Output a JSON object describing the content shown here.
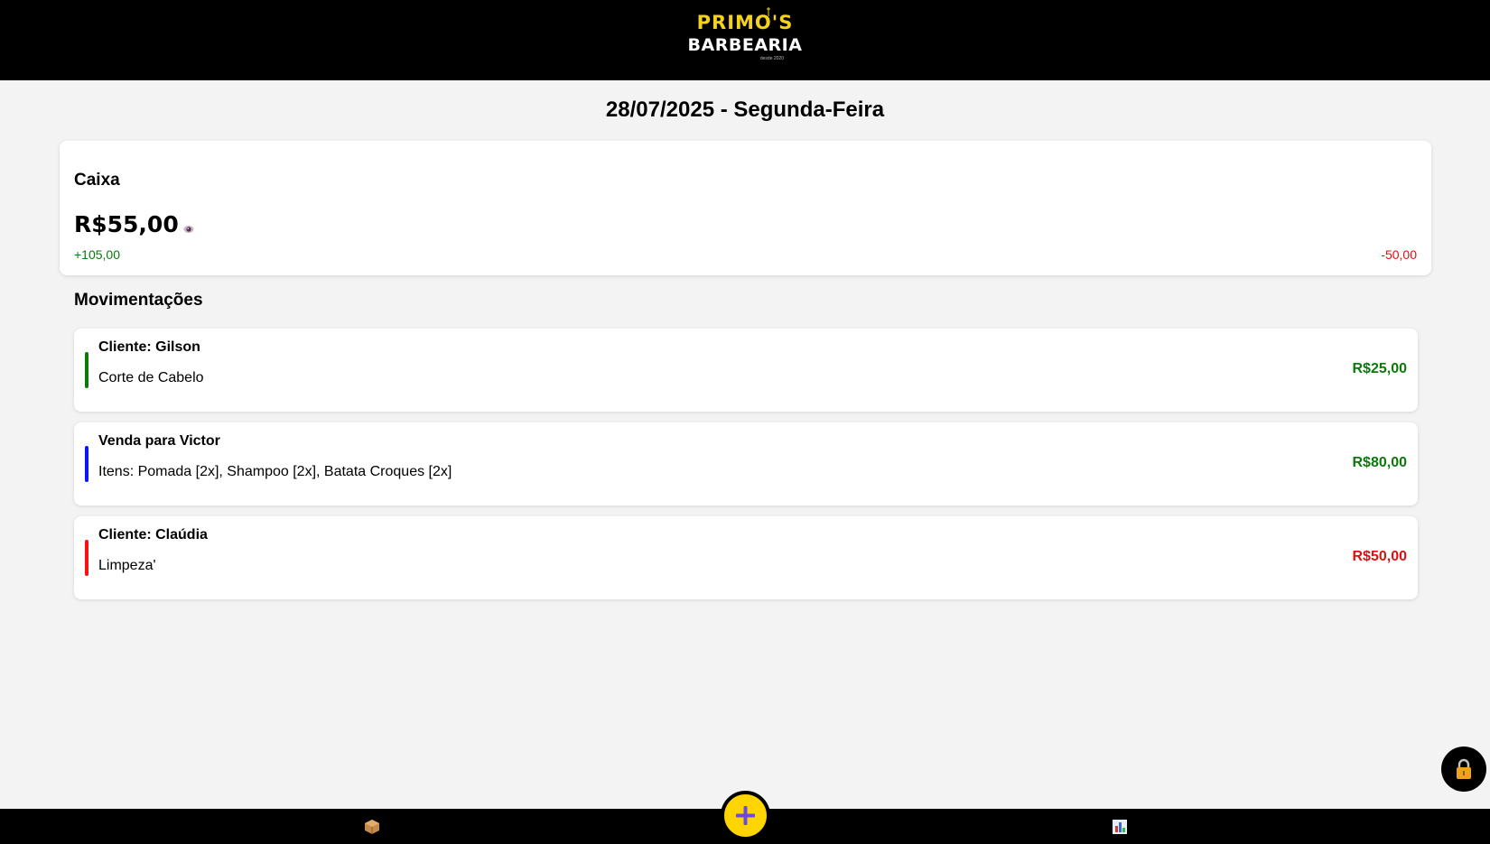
{
  "header": {
    "logo_line1": "PRIMO'S",
    "logo_line2": "BARBEARIA",
    "logo_tagline": "desde 2020"
  },
  "date_title": "28/07/2025 - Segunda-Feira",
  "cash": {
    "label": "Caixa",
    "balance": "R$55,00",
    "incoming": "+105,00",
    "outgoing": "-50,00"
  },
  "movements": {
    "title": "Movimentações",
    "items": [
      {
        "title": "Cliente: Gilson",
        "description": "Corte de Cabelo",
        "amount": "R$25,00",
        "bar_color": "#0a7a0a",
        "amount_color": "#0a7a0a"
      },
      {
        "title": "Venda para Victor",
        "description": "Itens: Pomada [2x], Shampoo [2x], Batata Croques [2x]",
        "amount": "R$80,00",
        "bar_color": "#0a14ff",
        "amount_color": "#0a7a0a"
      },
      {
        "title": "Cliente: Claúdia",
        "description": "Limpeza'",
        "amount": "R$50,00",
        "bar_color": "#ff1010",
        "amount_color": "#e01010"
      }
    ]
  },
  "icons": {
    "eye": "eye-icon",
    "lock": "lock-icon",
    "products": "package-icon",
    "add": "plus-icon",
    "reports": "bar-chart-icon"
  },
  "colors": {
    "brand_yellow": "#ffd500",
    "income_green": "#0a7a0a",
    "expense_red": "#e01010",
    "header_bg": "#000000"
  }
}
